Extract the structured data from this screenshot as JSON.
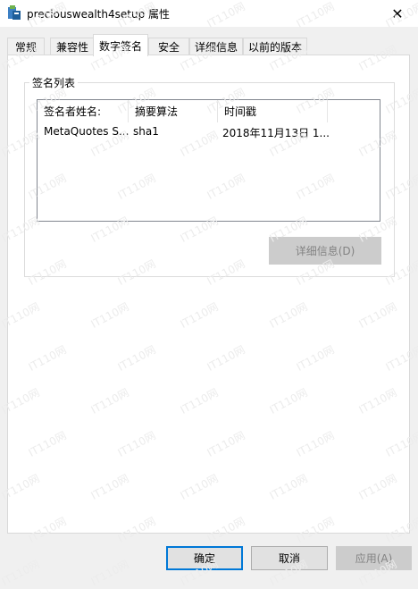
{
  "window": {
    "title": "preciouswealth4setup 属性",
    "close_glyph": "✕"
  },
  "tabs": [
    {
      "label": "常规"
    },
    {
      "label": "兼容性"
    },
    {
      "label": "数字签名",
      "active": true
    },
    {
      "label": "安全"
    },
    {
      "label": "详细信息"
    },
    {
      "label": "以前的版本"
    }
  ],
  "signature_list": {
    "group_label": "签名列表",
    "columns": [
      "签名者姓名:",
      "摘要算法",
      "时间戳"
    ],
    "rows": [
      [
        "MetaQuotes S...",
        "sha1",
        "2018年11月13日 1..."
      ]
    ]
  },
  "details_button": {
    "label": "详细信息(D)",
    "enabled": false
  },
  "footer_buttons": {
    "ok": "确定",
    "cancel": "取消",
    "apply": "应用(A)"
  },
  "watermark_text": "IT110网",
  "colors": {
    "accent": "#0078d7",
    "disabled_text": "#838383",
    "disabled_bg": "#cccccc"
  }
}
